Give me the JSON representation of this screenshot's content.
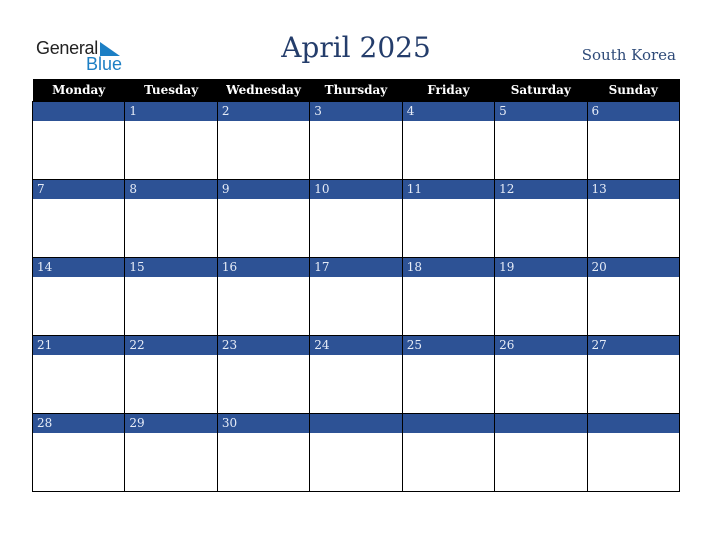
{
  "logo": {
    "word1": "General",
    "word2": "Blue",
    "accent_color": "#1d7fc4"
  },
  "title": "April 2025",
  "country": "South Korea",
  "weekdays": [
    "Monday",
    "Tuesday",
    "Wednesday",
    "Thursday",
    "Friday",
    "Saturday",
    "Sunday"
  ],
  "weeks": [
    [
      "",
      "1",
      "2",
      "3",
      "4",
      "5",
      "6"
    ],
    [
      "7",
      "8",
      "9",
      "10",
      "11",
      "12",
      "13"
    ],
    [
      "14",
      "15",
      "16",
      "17",
      "18",
      "19",
      "20"
    ],
    [
      "21",
      "22",
      "23",
      "24",
      "25",
      "26",
      "27"
    ],
    [
      "28",
      "29",
      "30",
      "",
      "",
      "",
      ""
    ]
  ],
  "colors": {
    "header_bg": "#000000",
    "day_bar": "#2d5295",
    "title": "#243d6b"
  }
}
